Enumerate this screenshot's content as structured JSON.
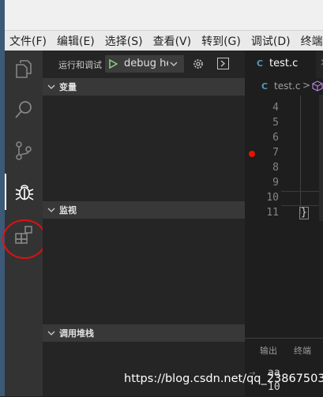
{
  "menu": [
    "文件(F)",
    "编辑(E)",
    "选择(S)",
    "查看(V)",
    "转到(G)",
    "调试(D)",
    "终端"
  ],
  "run_panel": {
    "label": "运行和调试",
    "config": "debug he"
  },
  "sections": {
    "variables": "变量",
    "watch": "监视",
    "call_stack": "调用堆栈"
  },
  "editor": {
    "tab_icon": "C",
    "tab_name": "test.c",
    "tab_close": "×",
    "breadcrumb_file": "test.c",
    "breadcrumb_sep": ">",
    "line_numbers": [
      "4",
      "5",
      "6",
      "7",
      "8",
      "9",
      "10",
      "11"
    ],
    "closing_brace": "}"
  },
  "panel": {
    "tabs": [
      "输出",
      "终端"
    ],
    "prompt": "→",
    "lines": [
      "aa",
      "10"
    ]
  },
  "watermark": "https://blog.csdn.net/qq_23867503",
  "icons": [
    "explorer-icon",
    "search-icon",
    "source-control-icon",
    "debug-icon",
    "extensions-icon",
    "play-icon",
    "gear-icon",
    "debug-console-icon",
    "symbol-cube-icon"
  ],
  "colors": {
    "activity_bar": "#333333",
    "sidebar": "#252526",
    "editor": "#1e1e1e",
    "breakpoint": "#e51400",
    "annotation": "#e01010",
    "play": "#89d185"
  }
}
